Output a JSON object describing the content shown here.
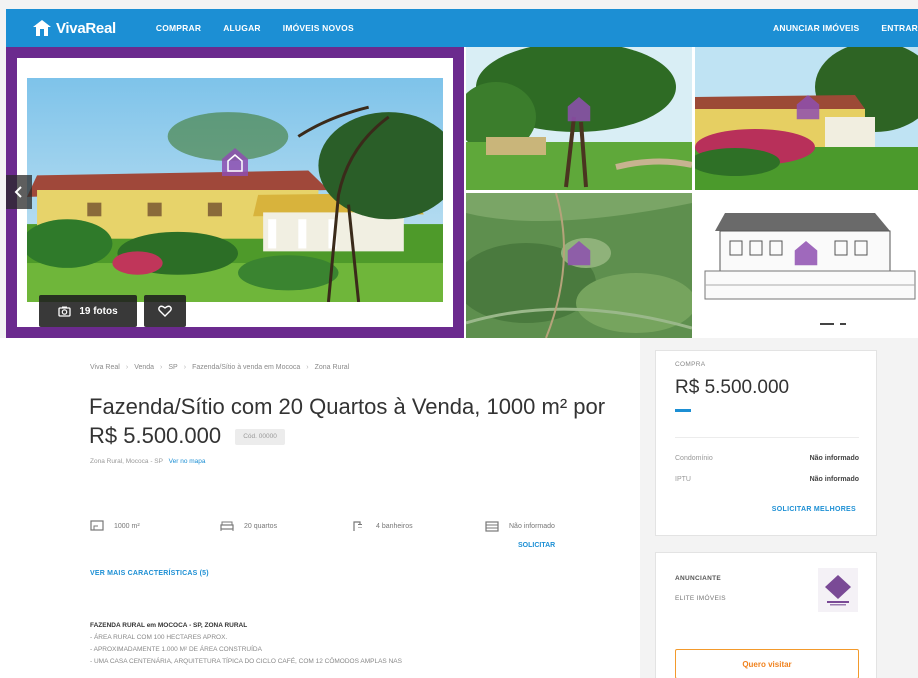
{
  "header": {
    "logo_text": "VivaReal",
    "nav": [
      "COMPRAR",
      "ALUGAR",
      "IMÓVEIS NOVOS"
    ],
    "nav_right": [
      "ANUNCIAR IMÓVEIS",
      "ENTRAR"
    ]
  },
  "gallery": {
    "photos_label": "19 fotos",
    "prev_icon": "chevron-left-icon",
    "fav_icon": "heart-icon"
  },
  "breadcrumb": [
    "Viva Real",
    "Venda",
    "SP",
    "Fazenda/Sítio à venda em Mococa",
    "Zona Rural"
  ],
  "listing": {
    "title": "Fazenda/Sítio com 20 Quartos à Venda, 1000 m² por R$ 5.500.000",
    "code": "Cód. 00000",
    "address": "Zona Rural, Mococa - SP",
    "map_link": "Ver no mapa",
    "features": [
      {
        "icon": "area-icon",
        "text": "1000 m²"
      },
      {
        "icon": "bed-icon",
        "text": "20 quartos"
      },
      {
        "icon": "shower-icon",
        "text": "4 banheiros"
      },
      {
        "icon": "garage-icon",
        "text": "Não informado"
      }
    ],
    "request_label": "SOLICITAR",
    "more_link": "VER MAIS CARACTERÍSTICAS (5)",
    "description": {
      "heading": "FAZENDA RURAL em MOCOCA - SP, ZONA RURAL",
      "lines": [
        "- ÁREA RURAL COM 100 HECTARES APROX.",
        "- APROXIMADAMENTE 1.000 M² DE ÁREA CONSTRUÍDA",
        "- UMA CASA CENTENÁRIA, ARQUITETURA TÍPICA DO CICLO CAFÉ, COM 12 CÔMODOS AMPLAS NAS"
      ]
    }
  },
  "price_card": {
    "label": "COMPRA",
    "price": "R$ 5.500.000",
    "rows": [
      {
        "key": "Condomínio",
        "value": "Não informado"
      },
      {
        "key": "IPTU",
        "value": "Não informado"
      }
    ],
    "better_values": "SOLICITAR MELHORES"
  },
  "advertiser_card": {
    "label": "ANUNCIANTE",
    "name": "ELITE IMÓVEIS",
    "visit_button": "Quero visitar"
  },
  "colors": {
    "brand_blue": "#1c8fd4",
    "hero_frame": "#6b2a8e",
    "visit_orange": "#f0821e"
  }
}
